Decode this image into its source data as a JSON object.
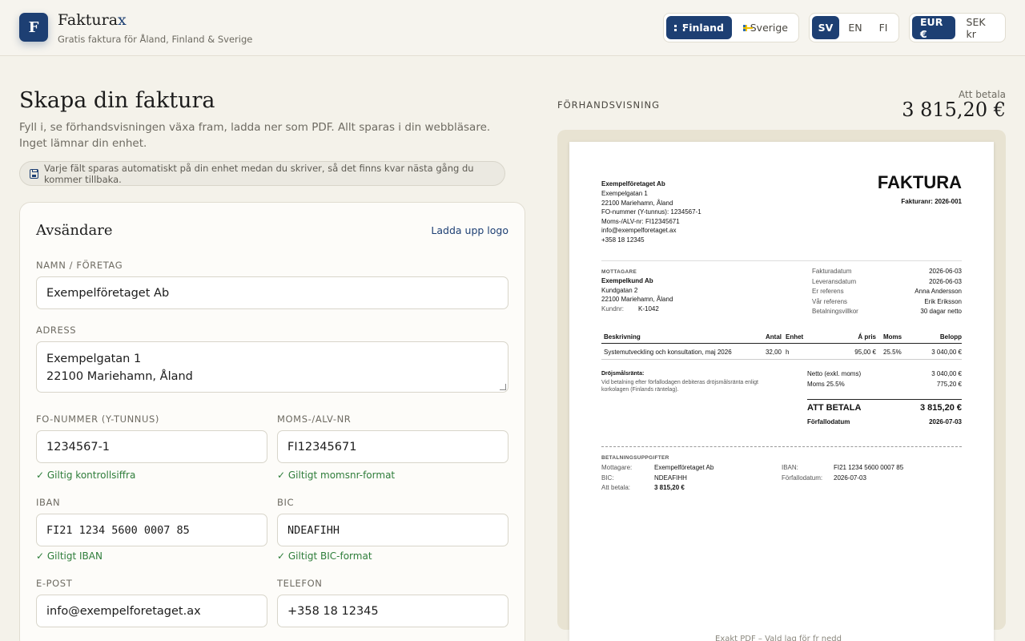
{
  "header": {
    "logo_letter": "F",
    "brand_main": "Faktura",
    "brand_accent": "x",
    "tagline": "Gratis faktura för Åland, Finland & Sverige",
    "countries": [
      "Finland",
      "Sverige"
    ],
    "languages": [
      "SV",
      "EN",
      "FI"
    ],
    "currencies": [
      "EUR €",
      "SEK kr"
    ]
  },
  "intro": {
    "title": "Skapa din faktura",
    "text": "Fyll i, se förhandsvisningen växa fram, ladda ner som PDF. Allt sparas i din webbläsare. Inget lämnar din enhet.",
    "autosave": "Varje fält sparas automatiskt på din enhet medan du skriver, så det finns kvar nästa gång du kommer tillbaka."
  },
  "sender": {
    "title": "Avsändare",
    "upload_logo": "Ladda upp logo",
    "name_label": "NAMN / FÖRETAG",
    "name_value": "Exempelföretaget Ab",
    "address_label": "ADRESS",
    "address_line1": "Exempelgatan 1",
    "address_line2": "22100 Mariehamn, Åland",
    "fo_label": "FO-NUMMER (Y-TUNNUS)",
    "fo_value": "1234567-1",
    "fo_valid": "✓ Giltig kontrollsiffra",
    "vat_label": "MOMS-/ALV-NR",
    "vat_value": "FI12345671",
    "vat_valid": "✓ Giltigt momsnr-format",
    "iban_label": "IBAN",
    "iban_value": "FI21 1234 5600 0007 85",
    "iban_valid": "✓ Giltigt IBAN",
    "bic_label": "BIC",
    "bic_value": "NDEAFIHH",
    "bic_valid": "✓ Giltigt BIC-format",
    "email_label": "E-POST",
    "email_value": "info@exempelforetaget.ax",
    "phone_label": "TELEFON",
    "phone_value": "+358 18 12345"
  },
  "preview": {
    "label": "FÖRHANDSVISNING",
    "pay_label": "Att betala",
    "pay_amount": "3 815,20 €",
    "footer_note": "Exakt PDF – Vald lag för fr nedd"
  },
  "invoice": {
    "sender_name": "Exempelföretaget Ab",
    "sender_lines": [
      "Exempelgatan 1",
      "22100 Mariehamn, Åland",
      "FO-nummer (Y-tunnus): 1234567-1",
      "Moms-/ALV-nr: FI12345671",
      "info@exempelforetaget.ax",
      "+358 18 12345"
    ],
    "title": "FAKTURA",
    "number": "Fakturanr: 2026-001",
    "recipient_caption": "MOTTAGARE",
    "recipient_name": "Exempelkund Ab",
    "recipient_lines": [
      "Kundgatan 2",
      "22100 Mariehamn, Åland"
    ],
    "customer_no_label": "Kundnr:",
    "customer_no": "K-1042",
    "meta": [
      {
        "label": "Fakturadatum",
        "value": "2026-06-03"
      },
      {
        "label": "Leveransdatum",
        "value": "2026-06-03"
      },
      {
        "label": "Er referens",
        "value": "Anna Andersson"
      },
      {
        "label": "Vår referens",
        "value": "Erik Eriksson"
      },
      {
        "label": "Betalningsvillkor",
        "value": "30 dagar netto"
      }
    ],
    "columns": [
      "Beskrivning",
      "Antal",
      "Enhet",
      "Á pris",
      "Moms",
      "Belopp"
    ],
    "row": [
      "Systemutveckling och konsultation, maj 2026",
      "32,00",
      "h",
      "95,00 €",
      "25.5%",
      "3 040,00 €"
    ],
    "late_title": "Dröjsmålsränta:",
    "late_text1": "Vid betalning efter förfallodagen debiteras dröjsmålsränta enligt",
    "late_text2": "korkolagen (Finlands räntelag).",
    "net_label": "Netto (exkl. moms)",
    "net_value": "3 040,00 €",
    "vat_label": "Moms 25.5%",
    "vat_value": "775,20 €",
    "total_label": "ATT BETALA",
    "total_value": "3 815,20 €",
    "due_label": "Förfallodatum",
    "due_value": "2026-07-03",
    "pay_caption": "BETALNINGSUPPGIFTER",
    "pay_recipient_label": "Mottagare:",
    "pay_recipient": "Exempelföretaget Ab",
    "pay_bic_label": "BIC:",
    "pay_bic": "NDEAFIHH",
    "pay_amount_label": "Att betala:",
    "pay_amount": "3 815,20 €",
    "pay_iban_label": "IBAN:",
    "pay_iban": "FI21 1234 5600 0007 85",
    "pay_due_label": "Förfallodatum:",
    "pay_due": "2026-07-03"
  }
}
